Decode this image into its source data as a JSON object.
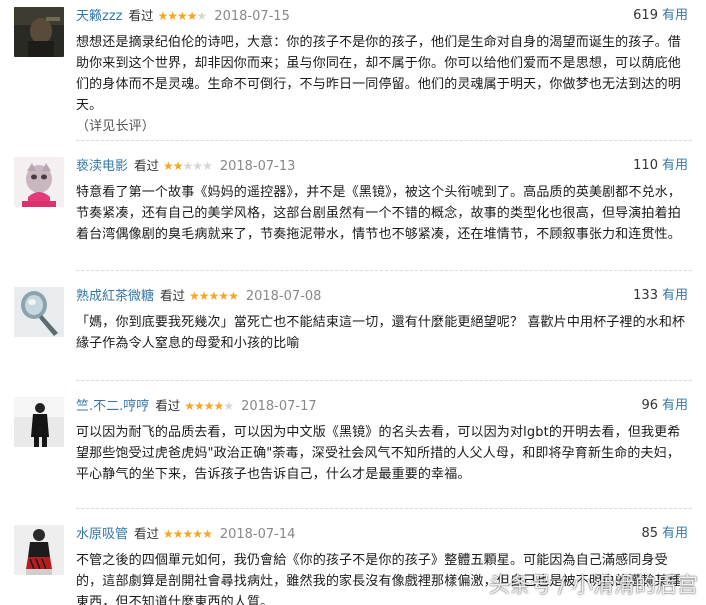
{
  "reviews": [
    {
      "user": "天籁zzz",
      "watched": "看过",
      "rating": 4,
      "stars_on": "★★★★",
      "stars_off": "★",
      "date": "2018-07-15",
      "votes": "619",
      "votes_label": "有用",
      "content": "想想还是摘录纪伯伦的诗吧，大意：你的孩子不是你的孩子，他们是生命对自身的渴望而诞生的孩子。借助你来到这个世界，却非因你而来；虽与你同在，却不属于你。你可以给他们爱而不是思想，可以荫庇他们的身体而不是灵魂。生命不可倒行，不与昨日一同停留。他们的灵魂属于明天，你做梦也无法到达的明天。",
      "more": "（详见长评）"
    },
    {
      "user": "亵渎电影",
      "watched": "看过",
      "rating": 2,
      "stars_on": "★★",
      "stars_off": "★★★",
      "date": "2018-07-13",
      "votes": "110",
      "votes_label": "有用",
      "content": "特意看了第一个故事《妈妈的遥控器》，并不是《黑镜》，被这个头衔唬到了。高品质的英美剧都不兑水，节奏紧凑，还有自己的美学风格，这部台剧虽然有一个不错的概念，故事的类型化也很高，但导演拍着拍着台湾偶像剧的臭毛病就来了，节奏拖泥带水，情节也不够紧凑，还在堆情节，不顾叙事张力和连贯性。",
      "more": ""
    },
    {
      "user": "熟成紅茶微糖",
      "watched": "看过",
      "rating": 5,
      "stars_on": "★★★★★",
      "stars_off": "",
      "date": "2018-07-08",
      "votes": "133",
      "votes_label": "有用",
      "content": "「媽，你到底要我死幾次」當死亡也不能結束這一切，還有什麼能更絕望呢？ 喜歡片中用杯子裡的水和杯緣子作為令人窒息的母愛和小孩的比喻",
      "more": ""
    },
    {
      "user": "竺.不二.哼哼",
      "watched": "看过",
      "rating": 4,
      "stars_on": "★★★★",
      "stars_off": "★",
      "date": "2018-07-17",
      "votes": "96",
      "votes_label": "有用",
      "content": "可以因为耐飞的品质去看，可以因为中文版《黑镜》的名头去看，可以因为对lgbt的开明去看，但我更希望那些饱受过虎爸虎妈\"政治正确\"荼毒，深受社会风气不知所措的人父人母，和即将孕育新生命的夫妇，平心静气的坐下来，告诉孩子也告诉自己，什么才是最重要的幸福。",
      "more": ""
    },
    {
      "user": "水原吸管",
      "watched": "看过",
      "rating": 5,
      "stars_on": "★★★★★",
      "stars_off": "",
      "date": "2018-07-14",
      "votes": "85",
      "votes_label": "有用",
      "content": "不管之後的四個單元如何，我仍會給《你的孩子不是你的孩子》整體五顆星。可能因為自己滿感同身受的，這部劇算是剖開社會尋找病灶，雖然我的家長沒有像戲裡那樣偏激，但自己也是被不明白的灌輸某種東西，但不知道什麼東西的人質。",
      "more": ""
    }
  ],
  "watermark": "头条号 / 小滑滑的后宫"
}
